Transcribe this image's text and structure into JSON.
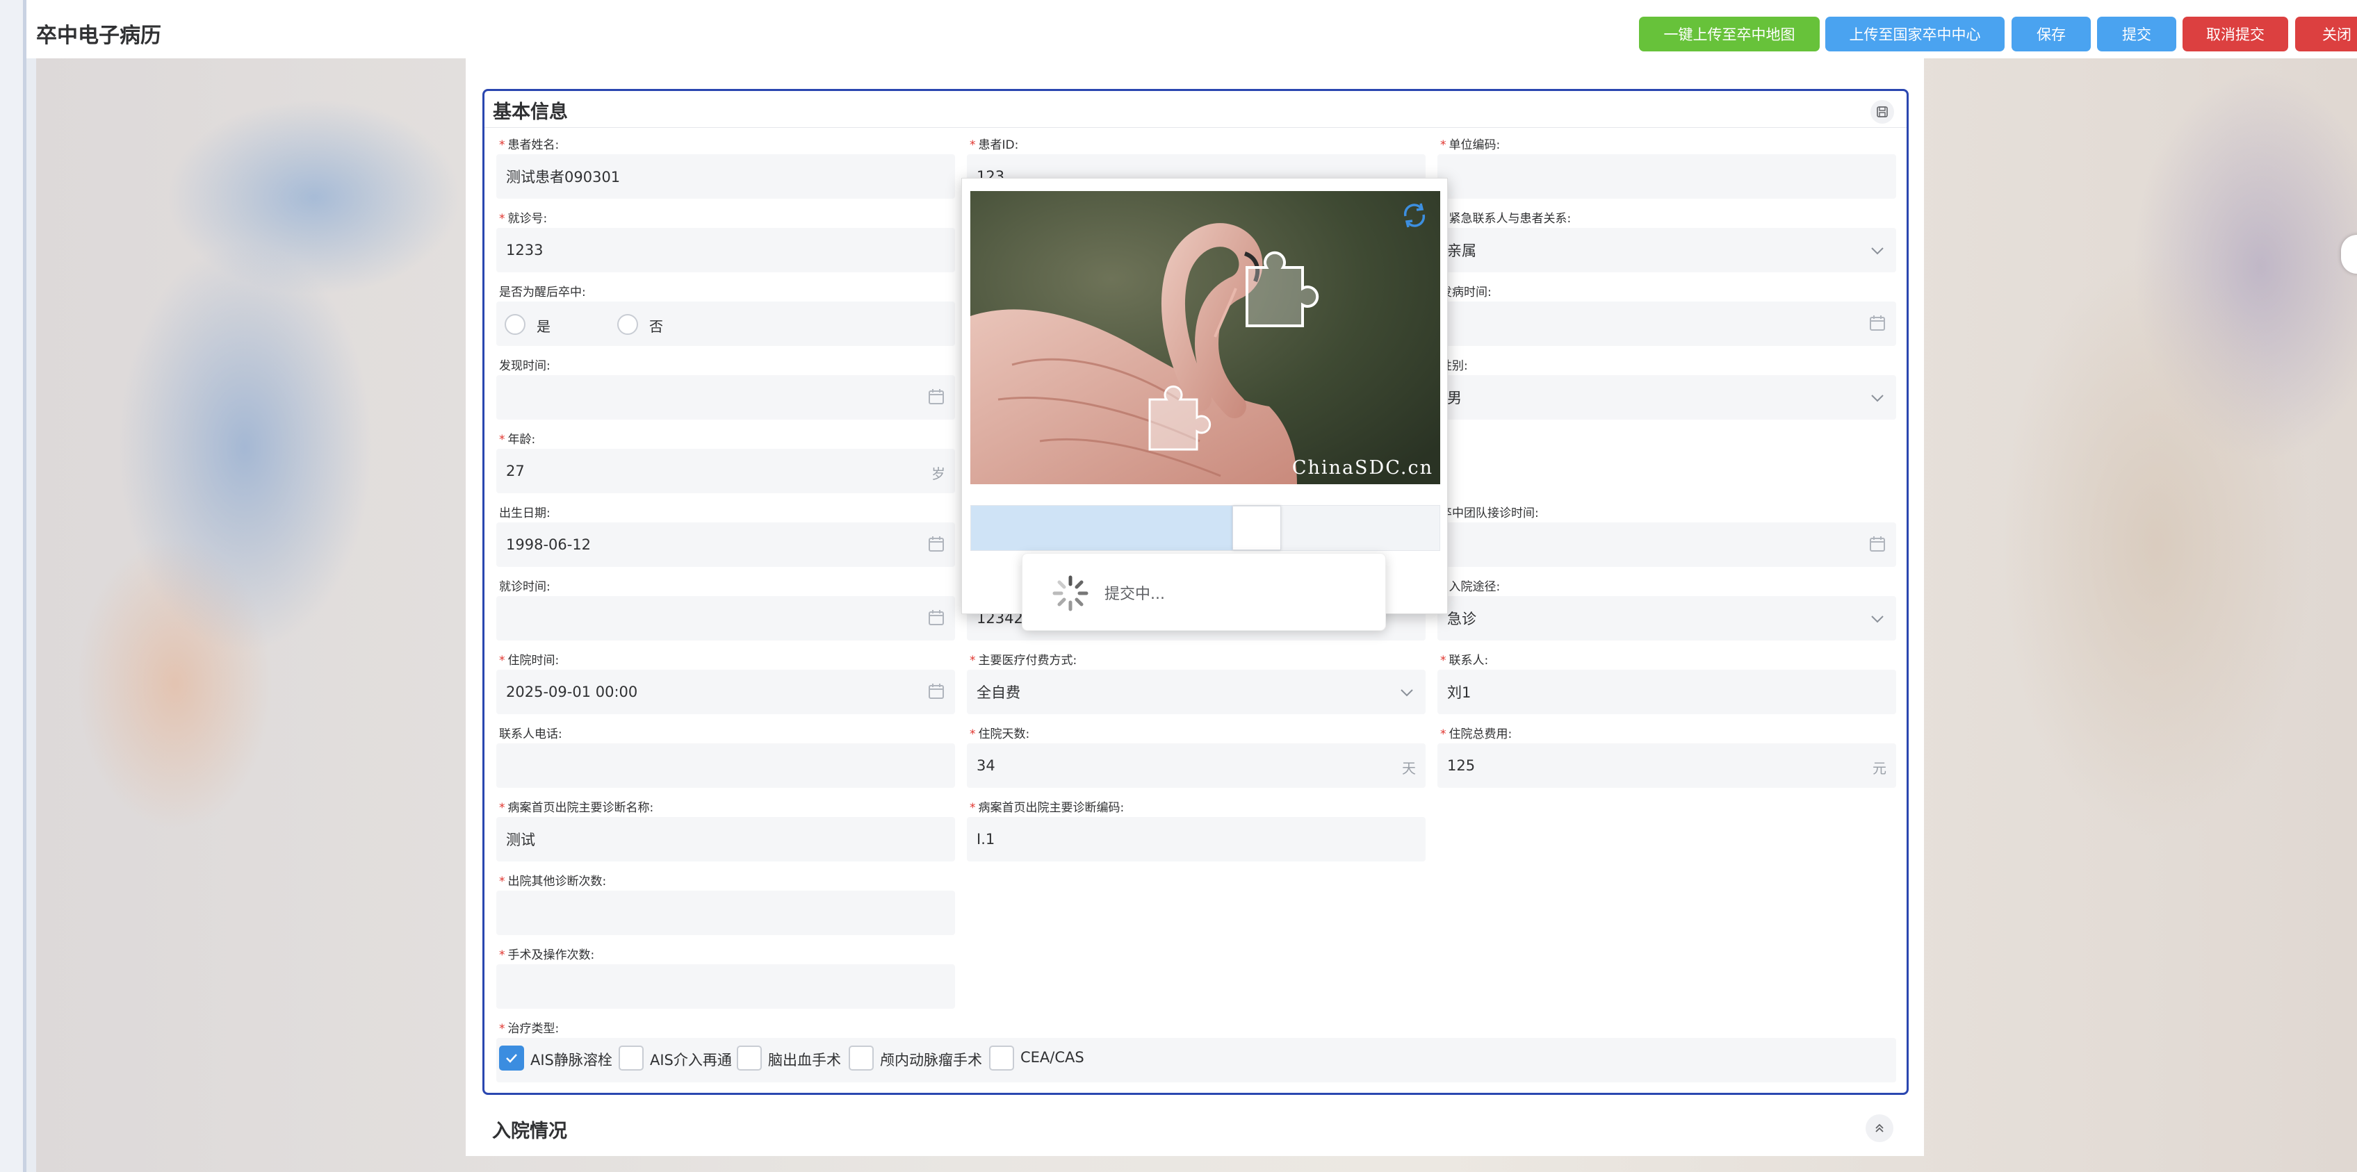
{
  "app_title": "卒中电子病历",
  "toolbar": {
    "upload_map": "一键上传至卒中地图",
    "upload_national": "上传至国家卒中中心",
    "save": "保存",
    "submit": "提交",
    "cancel_submit": "取消提交",
    "close": "关闭"
  },
  "colors": {
    "green": "#67c23a",
    "blue": "#4aa3f0",
    "red": "#dc4040",
    "border_blue": "#2b47b0",
    "check_blue": "#3b8de0"
  },
  "section1": {
    "title": "基本信息"
  },
  "section2": {
    "title": "入院情况"
  },
  "fields": {
    "patient_name": {
      "label": "患者姓名:",
      "value": "测试患者090301"
    },
    "patient_id": {
      "label": "患者ID:",
      "value": "123"
    },
    "unit_code": {
      "label": "单位编码:",
      "value": ""
    },
    "visit_no": {
      "label": "就诊号:",
      "value": "1233"
    },
    "emergency_relation": {
      "label": "紧急联系人与患者关系:",
      "value": "亲属"
    },
    "wake_stroke": {
      "label": "是否为醒后卒中:",
      "yes": "是",
      "no": "否"
    },
    "onset_time": {
      "label": "发病时间:",
      "value": ""
    },
    "found_time": {
      "label": "发现时间:",
      "value": ""
    },
    "gender": {
      "label": "性别:",
      "value": "男"
    },
    "age": {
      "label": "年龄:",
      "value": "27",
      "unit": "岁"
    },
    "birth_date": {
      "label": "出生日期:",
      "value": "1998-06-12"
    },
    "team_time": {
      "label": "卒中团队接诊时间:",
      "value": ""
    },
    "visit_time": {
      "label": "就诊时间:",
      "value": ""
    },
    "middle_value": {
      "value": "123423"
    },
    "admission_route": {
      "label": "入院途径:",
      "value": "急诊"
    },
    "admission_time": {
      "label": "住院时间:",
      "value": "2025-09-01 00:00"
    },
    "payment": {
      "label": "主要医疗付费方式:",
      "value": "全自费"
    },
    "contact": {
      "label": "联系人:",
      "value": "刘1"
    },
    "contact_phone": {
      "label": "联系人电话:",
      "value": ""
    },
    "stay_days": {
      "label": "住院天数:",
      "value": "34",
      "unit": "天"
    },
    "total_cost": {
      "label": "住院总费用:",
      "value": "125",
      "unit": "元"
    },
    "diag_name": {
      "label": "病案首页出院主要诊断名称:",
      "value": "测试"
    },
    "diag_code": {
      "label": "病案首页出院主要诊断编码:",
      "value": "I.1"
    },
    "other_diag": {
      "label": "出院其他诊断次数:",
      "value": ""
    },
    "surgery_count": {
      "label": "手术及操作次数:",
      "value": ""
    },
    "treatment": {
      "label": "治疗类型:",
      "options": [
        {
          "label": "AIS静脉溶栓",
          "checked": true
        },
        {
          "label": "AIS介入再通",
          "checked": false
        },
        {
          "label": "脑出血手术",
          "checked": false
        },
        {
          "label": "颅内动脉瘤手术",
          "checked": false
        },
        {
          "label": "CEA/CAS",
          "checked": false
        }
      ]
    }
  },
  "captcha": {
    "brand": "ChinaSDC.cn",
    "icon": "refresh-icon",
    "slider_progress": 0.62
  },
  "loading": {
    "text": "提交中..."
  }
}
